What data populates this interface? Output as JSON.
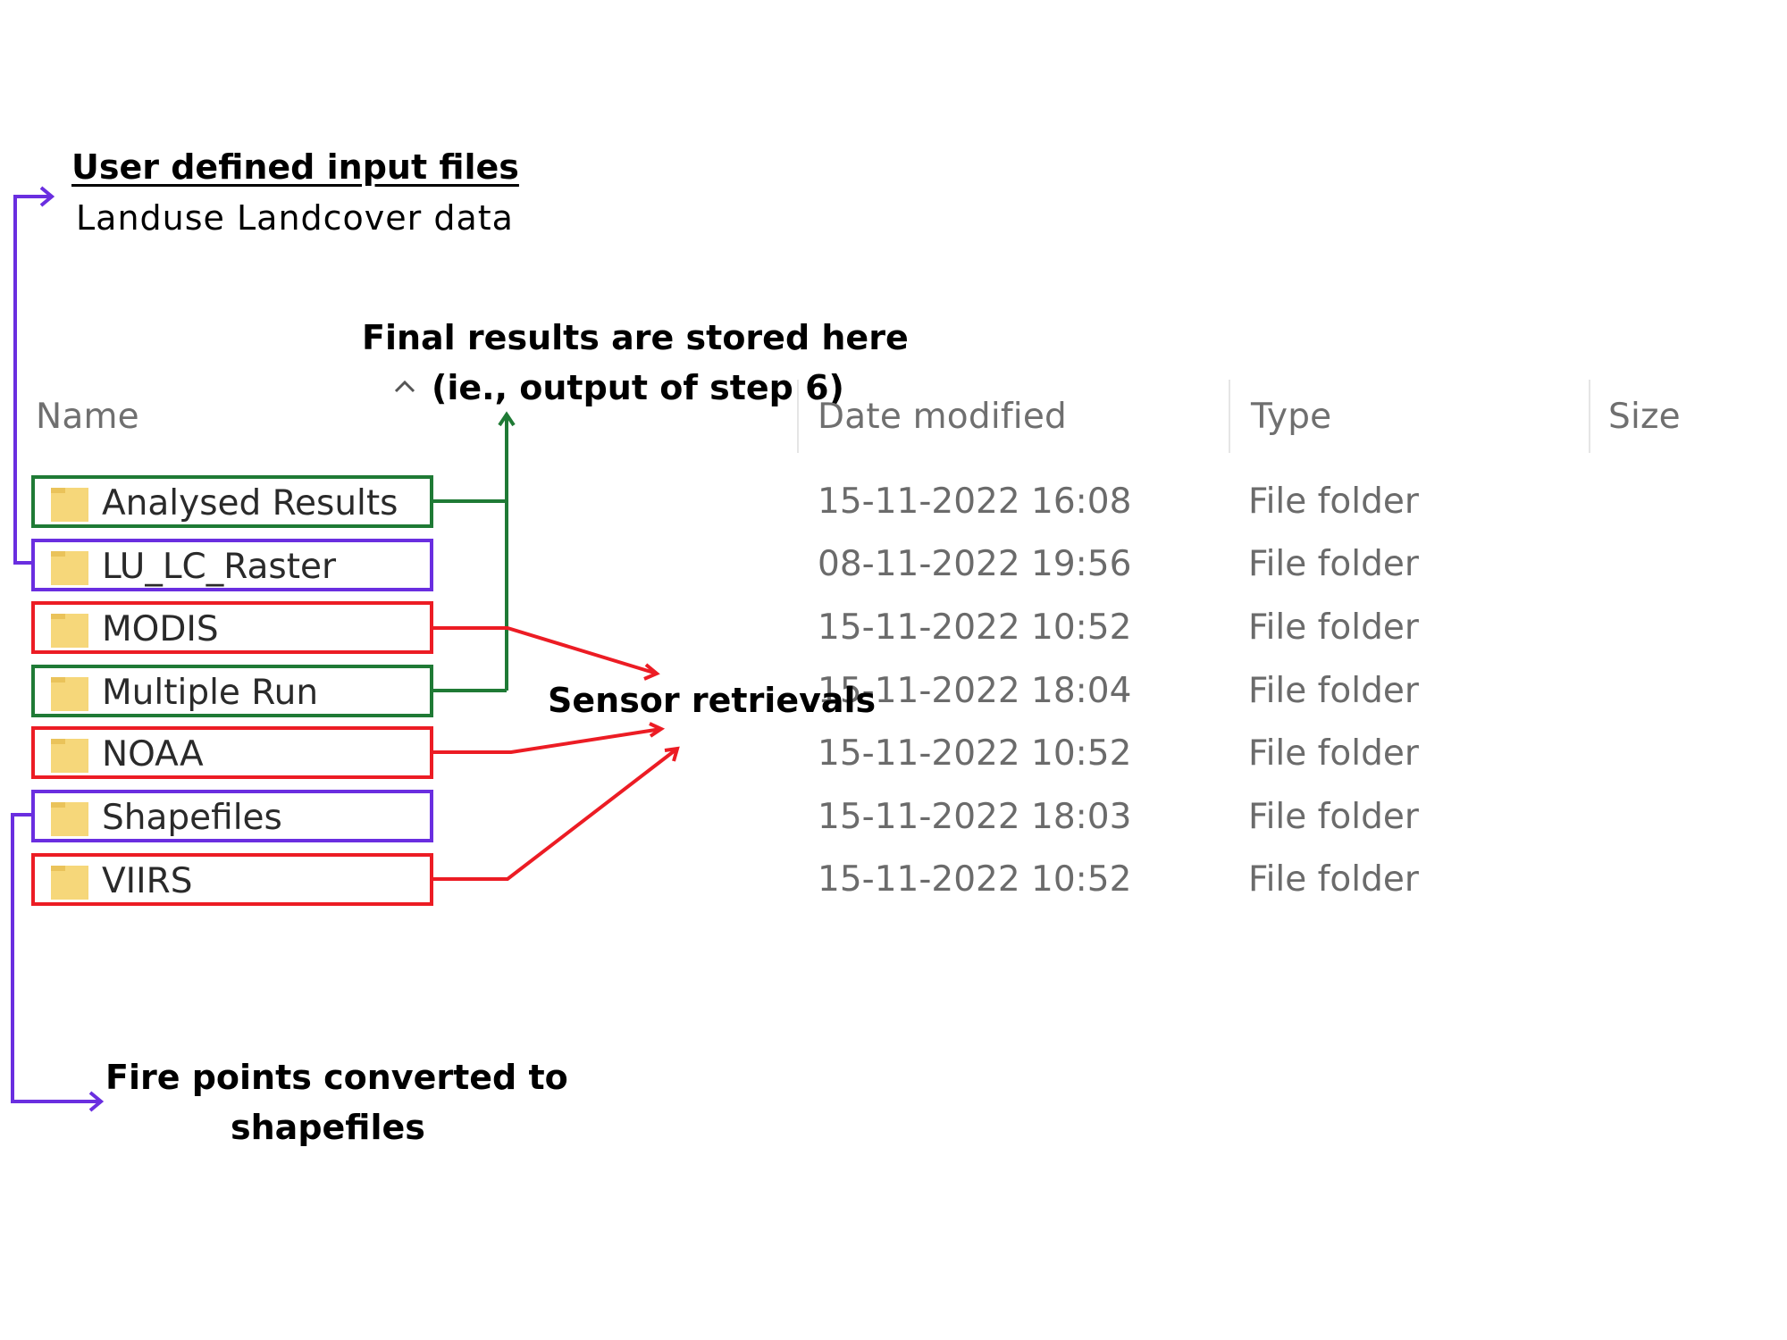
{
  "annotations": {
    "user_defined_title": "User defined input files",
    "user_defined_sub": "Landuse Landcover data",
    "final_results_line1": "Final results are stored here",
    "final_results_line2": "(ie., output of step 6)",
    "sensor_retrievals": "Sensor retrievals",
    "fire_points_line1": "Fire points converted to",
    "fire_points_line2": "shapefiles"
  },
  "columns": {
    "name": "Name",
    "date_modified": "Date modified",
    "type": "Type",
    "size": "Size",
    "sort_icon": "chevron-up-icon"
  },
  "rows": [
    {
      "name": "Analysed Results",
      "date": "15-11-2022 16:08",
      "type": "File folder",
      "icon": "folder-icon",
      "highlight": "green"
    },
    {
      "name": "LU_LC_Raster",
      "date": "08-11-2022 19:56",
      "type": "File folder",
      "icon": "folder-icon",
      "highlight": "purple"
    },
    {
      "name": "MODIS",
      "date": "15-11-2022 10:52",
      "type": "File folder",
      "icon": "folder-icon",
      "highlight": "red"
    },
    {
      "name": "Multiple Run",
      "date": "15-11-2022 18:04",
      "type": "File folder",
      "icon": "folder-icon",
      "highlight": "green"
    },
    {
      "name": "NOAA",
      "date": "15-11-2022 10:52",
      "type": "File folder",
      "icon": "folder-icon",
      "highlight": "red"
    },
    {
      "name": "Shapefiles",
      "date": "15-11-2022 18:03",
      "type": "File folder",
      "icon": "folder-icon",
      "highlight": "purple"
    },
    {
      "name": "VIIRS",
      "date": "15-11-2022 10:52",
      "type": "File folder",
      "icon": "folder-icon",
      "highlight": "red"
    }
  ],
  "colors": {
    "green": "#1f7a35",
    "purple": "#6a2ee0",
    "red": "#ec1c24",
    "folder": "#f6d77a"
  }
}
